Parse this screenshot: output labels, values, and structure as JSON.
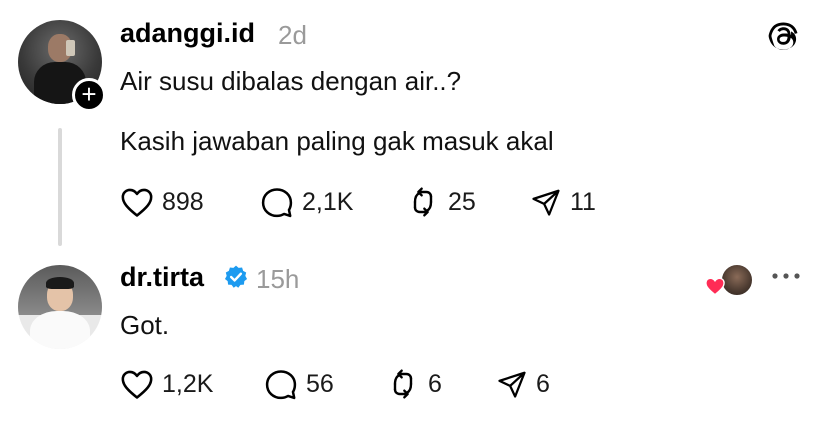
{
  "post": {
    "username": "adanggi.id",
    "time": "2d",
    "lines": [
      "Air susu dibalas dengan air..?",
      "Kasih jawaban paling gak masuk akal"
    ],
    "likes": "898",
    "replies": "2,1K",
    "reposts": "25",
    "shares": "11"
  },
  "reply": {
    "username": "dr.tirta",
    "time": "15h",
    "text": "Got.",
    "likes": "1,2K",
    "replies": "56",
    "reposts": "6",
    "shares": "6"
  },
  "icons": {
    "like": "heart-outline-icon",
    "reply": "speech-bubble-icon",
    "repost": "repost-arrows-icon",
    "share": "paper-plane-icon",
    "verified": "blue-check-badge-icon",
    "follow": "plus-icon",
    "brand": "threads-logo-icon",
    "more": "ellipsis-icon"
  },
  "colors": {
    "verified": "#1d9bf0",
    "liked_heart": "#ff2c55",
    "muted": "#9a9a9a",
    "thread_line": "#d9d9d9"
  }
}
